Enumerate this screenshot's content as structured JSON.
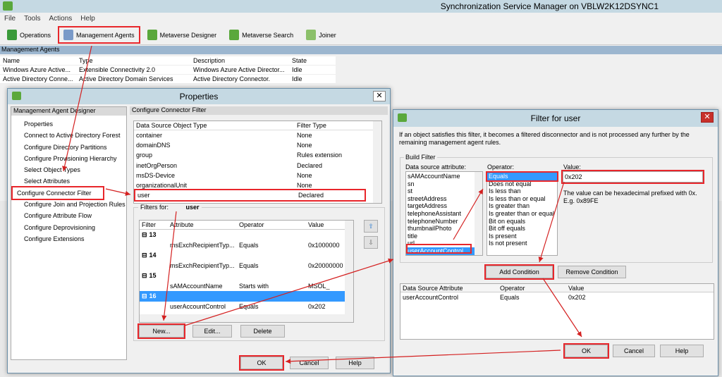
{
  "app": {
    "title": "Synchronization Service Manager on VBLW2K12DSYNC1"
  },
  "menu": [
    "File",
    "Tools",
    "Actions",
    "Help"
  ],
  "toolbar": [
    {
      "label": "Operations",
      "color": "#3a9a3a"
    },
    {
      "label": "Management Agents",
      "color": "#7a9ac8"
    },
    {
      "label": "Metaverse Designer",
      "color": "#5aa83c"
    },
    {
      "label": "Metaverse Search",
      "color": "#5aa83c"
    },
    {
      "label": "Joiner",
      "color": "#8cc06a"
    }
  ],
  "agents": {
    "section": "Management Agents",
    "columns": [
      "Name",
      "Type",
      "Description",
      "State"
    ],
    "rows": [
      [
        "Windows Azure Active...",
        "Extensible Connectivity 2.0",
        "Windows Azure Active Director...",
        "Idle"
      ],
      [
        "Active Directory Conne...",
        "Active Directory Domain Services",
        "Active Directory Connector.",
        "Idle"
      ]
    ]
  },
  "properties": {
    "title": "Properties",
    "close": "✕",
    "designer_header": "Management Agent Designer",
    "nav": [
      "Properties",
      "Connect to Active Directory Forest",
      "Configure Directory Partitions",
      "Configure Provisioning Hierarchy",
      "Select Object Types",
      "Select Attributes",
      "Configure Connector Filter",
      "Configure Join and Projection Rules",
      "Configure Attribute Flow",
      "Configure Deprovisioning",
      "Configure Extensions"
    ],
    "section": "Configure Connector Filter",
    "obj_columns": [
      "Data Source Object Type",
      "Filter Type"
    ],
    "objects": [
      [
        "container",
        "None"
      ],
      [
        "domainDNS",
        "None"
      ],
      [
        "group",
        "Rules extension"
      ],
      [
        "inetOrgPerson",
        "Declared"
      ],
      [
        "msDS-Device",
        "None"
      ],
      [
        "organizationalUnit",
        "None"
      ],
      [
        "user",
        "Declared"
      ]
    ],
    "filters_for_label": "Filters for:",
    "filters_for_value": "user",
    "filter_columns": [
      "Filter",
      "Attribute",
      "Operator",
      "Value"
    ],
    "filters": [
      {
        "id": "13",
        "attr": "msExchRecipientTyp...",
        "op": "Equals",
        "val": "0x1000000"
      },
      {
        "id": "14",
        "attr": "msExchRecipientTyp...",
        "op": "Equals",
        "val": "0x20000000"
      },
      {
        "id": "15",
        "attr": "sAMAccountName",
        "op": "Starts with",
        "val": "MSOL_"
      },
      {
        "id": "16",
        "attr": "userAccountControl",
        "op": "Equals",
        "val": "0x202"
      }
    ],
    "new": "New...",
    "edit": "Edit...",
    "delete": "Delete",
    "ok": "OK",
    "cancel": "Cancel",
    "help": "Help"
  },
  "filter_dialog": {
    "title": "Filter for user",
    "close": "✕",
    "description": "If an object satisfies this filter, it becomes a filtered disconnector and is not processed any further by the remaining management agent rules.",
    "build_filter": "Build Filter",
    "attr_label": "Data source attribute:",
    "attributes": [
      "sAMAccountName",
      "sn",
      "st",
      "streetAddress",
      "targetAddress",
      "telephoneAssistant",
      "telephoneNumber",
      "thumbnailPhoto",
      "title",
      "url",
      "userAccountControl"
    ],
    "operator_label": "Operator:",
    "operators": [
      "Equals",
      "Does not equal",
      "Is less than",
      "Is less than or equal",
      "Is greater than",
      "Is greater than or equal",
      "Bit on equals",
      "Bit off equals",
      "Is present",
      "Is not present"
    ],
    "value_label": "Value:",
    "value": "0x202",
    "hint": "The value can be hexadecimal prefixed with 0x. E.g. 0x89FE",
    "add": "Add Condition",
    "remove": "Remove Condition",
    "cond_columns": [
      "Data Source Attribute",
      "Operator",
      "Value"
    ],
    "conditions": [
      [
        "userAccountControl",
        "Equals",
        "0x202"
      ]
    ],
    "ok": "OK",
    "cancel": "Cancel",
    "help": "Help"
  }
}
